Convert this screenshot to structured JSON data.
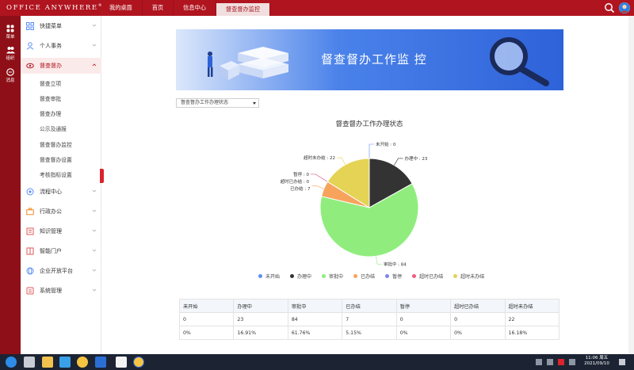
{
  "app": {
    "logo": "Office Anywhere",
    "logo_mark": "®"
  },
  "tabs": [
    {
      "label": "我的桌面"
    },
    {
      "label": "首页"
    },
    {
      "label": "信息中心"
    },
    {
      "label": "督查督办监控"
    }
  ],
  "rail": [
    {
      "label": "菜单"
    },
    {
      "label": "组织"
    },
    {
      "label": "消息"
    }
  ],
  "sidebar": {
    "items": [
      {
        "label": "快捷菜单"
      },
      {
        "label": "个人事务"
      },
      {
        "label": "督查督办"
      },
      {
        "label": "流程中心"
      },
      {
        "label": "行政办公"
      },
      {
        "label": "知识管理"
      },
      {
        "label": "智能门户"
      },
      {
        "label": "企业开放平台"
      },
      {
        "label": "系统管理"
      }
    ],
    "subitems": [
      {
        "label": "督查立项"
      },
      {
        "label": "督查审批"
      },
      {
        "label": "督查办理"
      },
      {
        "label": "公示及通报"
      },
      {
        "label": "督查督办监控"
      },
      {
        "label": "督查督办设置"
      },
      {
        "label": "考核指标设置"
      }
    ]
  },
  "banner": {
    "title": "督查督办工作监 控"
  },
  "filter": {
    "selected": "督查督办工作办理状态"
  },
  "chart_data": {
    "type": "pie",
    "title": "督查督办工作办理状态",
    "slices": [
      {
        "name": "未开始",
        "value": 0,
        "label": "未开始 : 0",
        "color": "#5b8ff9"
      },
      {
        "name": "办理中",
        "value": 23,
        "label": "办理中 : 23",
        "color": "#333333"
      },
      {
        "name": "审批中",
        "value": 84,
        "label": "审批中 : 84",
        "color": "#90ed7d"
      },
      {
        "name": "已办结",
        "value": 7,
        "label": "已办结 : 7",
        "color": "#f7a35c"
      },
      {
        "name": "暂停",
        "value": 0,
        "label": "暂停 : 0",
        "color": "#8085e9"
      },
      {
        "name": "超时已办结",
        "value": 0,
        "label": "超时已办结 : 0",
        "color": "#f15c80"
      },
      {
        "name": "超时未办结",
        "value": 22,
        "label": "超时未办结 : 22",
        "color": "#e4d354"
      }
    ],
    "legend_position": "bottom"
  },
  "table": {
    "headers": [
      "未开始",
      "办理中",
      "审批中",
      "已办结",
      "暂停",
      "超时已办结",
      "超时未办结"
    ],
    "counts": [
      "0",
      "23",
      "84",
      "7",
      "0",
      "0",
      "22"
    ],
    "percents": [
      "0%",
      "16.91%",
      "61.76%",
      "5.15%",
      "0%",
      "0%",
      "16.18%"
    ]
  },
  "taskbar": {
    "time": "11:06 周五",
    "date": "2021/09/10"
  },
  "colors": {
    "brand": "#b0141f",
    "rail": "#8e0f17",
    "accent_blue": "#2e62d9"
  }
}
